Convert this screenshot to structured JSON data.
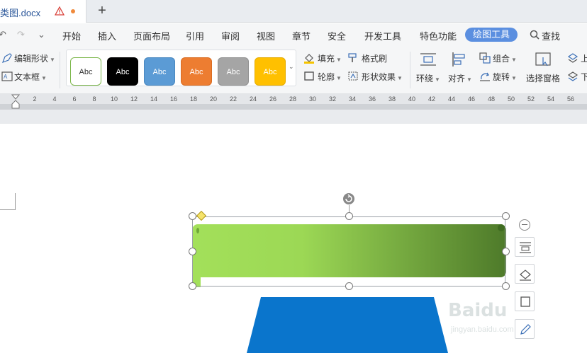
{
  "tabbar": {
    "doc_title": "类图.docx",
    "new_tab": "+"
  },
  "menubar": {
    "undo": "↶",
    "redo": "↷",
    "more": "⌄",
    "items": [
      "开始",
      "插入",
      "页面布局",
      "引用",
      "审阅",
      "视图",
      "章节",
      "安全",
      "开发工具",
      "特色功能"
    ],
    "active": "绘图工具",
    "search": "查找"
  },
  "ribbon": {
    "edit_shape": "编辑形状",
    "text_box": "文本框",
    "styles": [
      {
        "label": "Abc",
        "bg": "#ffffff",
        "fg": "#333333",
        "border": "#7ab648"
      },
      {
        "label": "Abc",
        "bg": "#000000",
        "fg": "#ffffff",
        "border": "#000000"
      },
      {
        "label": "Abc",
        "bg": "#5b9bd5",
        "fg": "#ffffff",
        "border": "#4a88c0"
      },
      {
        "label": "Abc",
        "bg": "#ed7d31",
        "fg": "#ffffff",
        "border": "#d96c22"
      },
      {
        "label": "Abc",
        "bg": "#a5a5a5",
        "fg": "#ffffff",
        "border": "#929292"
      },
      {
        "label": "Abc",
        "bg": "#ffc000",
        "fg": "#ffffff",
        "border": "#e6ac00"
      }
    ],
    "fill": "填充",
    "format_painter": "格式刷",
    "outline": "轮廓",
    "shape_effects": "形状效果",
    "wrap": "环绕",
    "align": "对齐",
    "group": "组合",
    "rotate": "旋转",
    "selection_pane": "选择窗格",
    "up": "上",
    "down": "下"
  },
  "ruler": {
    "ticks": [
      "2",
      "4",
      "6",
      "8",
      "10",
      "12",
      "14",
      "16",
      "18",
      "20",
      "22",
      "24",
      "26",
      "28",
      "30",
      "32",
      "34",
      "36",
      "38",
      "40",
      "42",
      "44",
      "46",
      "48",
      "50",
      "52",
      "54",
      "56"
    ]
  },
  "colors": {
    "accent": "#5b8fe0",
    "green_light": "#a3e05a",
    "green_dark": "#4e7a2a",
    "blue_shape": "#0a75cc"
  },
  "watermark": {
    "brand": "Baidu",
    "url": "jingyan.baidu.com"
  }
}
